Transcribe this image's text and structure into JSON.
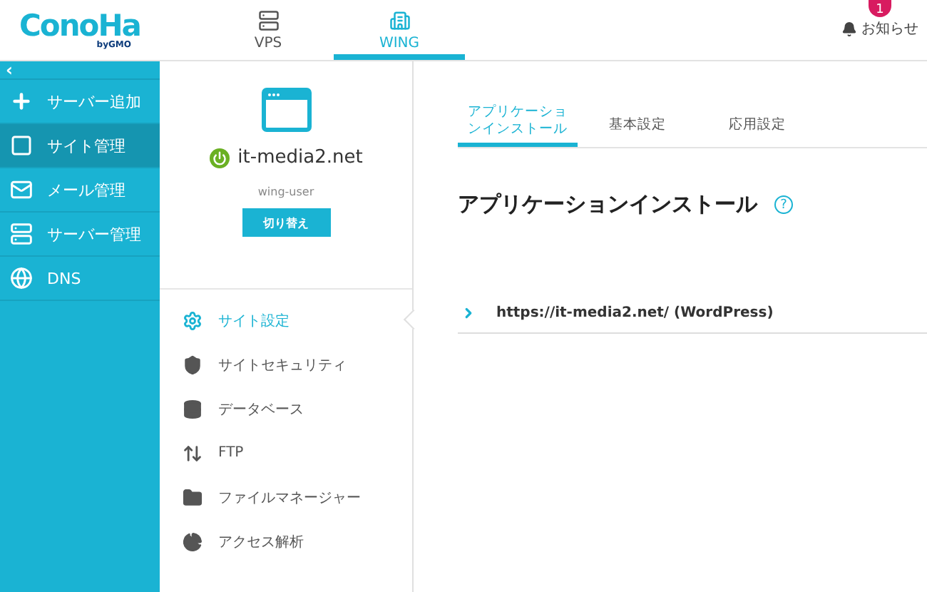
{
  "header": {
    "logo": "ConoHa",
    "logo_sub": "byGMO",
    "nav": [
      {
        "label": "VPS",
        "selected": false
      },
      {
        "label": "WING",
        "selected": true
      }
    ],
    "notification": {
      "badge": "1",
      "label": "お知らせ"
    }
  },
  "sidebar": {
    "collapse": "‹",
    "items": [
      {
        "label": "サーバー追加",
        "selected": false
      },
      {
        "label": "サイト管理",
        "selected": true
      },
      {
        "label": "メール管理",
        "selected": false
      },
      {
        "label": "サーバー管理",
        "selected": false
      },
      {
        "label": "DNS",
        "selected": false
      }
    ]
  },
  "site": {
    "domain": "it-media2.net",
    "user": "wing-user",
    "switch_button": "切り替え",
    "active": true
  },
  "site_menu": [
    {
      "label": "サイト設定",
      "selected": true
    },
    {
      "label": "サイトセキュリティ",
      "selected": false
    },
    {
      "label": "データベース",
      "selected": false
    },
    {
      "label": "FTP",
      "selected": false
    },
    {
      "label": "ファイルマネージャー",
      "selected": false
    },
    {
      "label": "アクセス解析",
      "selected": false
    }
  ],
  "tabs": [
    {
      "label": "アプリケーションインストール",
      "selected": true
    },
    {
      "label": "基本設定",
      "selected": false
    },
    {
      "label": "応用設定",
      "selected": false
    }
  ],
  "content": {
    "title": "アプリケーションインストール",
    "help": "?",
    "apps": [
      {
        "label": "https://it-media2.net/ (WordPress)",
        "expanded": false
      }
    ]
  }
}
